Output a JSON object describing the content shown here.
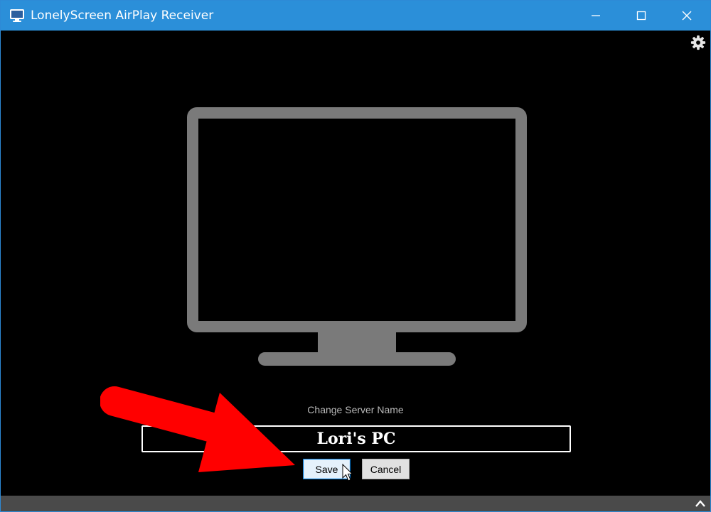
{
  "window": {
    "title": "LonelyScreen AirPlay Receiver",
    "controls": [
      "minimize",
      "maximize",
      "close"
    ]
  },
  "icons": {
    "app": "monitor-icon",
    "settings": "gear-icon",
    "expand": "chevron-up-icon"
  },
  "server": {
    "label": "Change Server Name",
    "name_value": "Lori's PC"
  },
  "buttons": {
    "save": "Save",
    "cancel": "Cancel"
  },
  "colors": {
    "titlebar": "#2b8fd9",
    "background": "#000000",
    "monitor": "#7a7a7a",
    "annotation_arrow": "#ff0000",
    "bottom_bar": "#4a4a4a"
  }
}
